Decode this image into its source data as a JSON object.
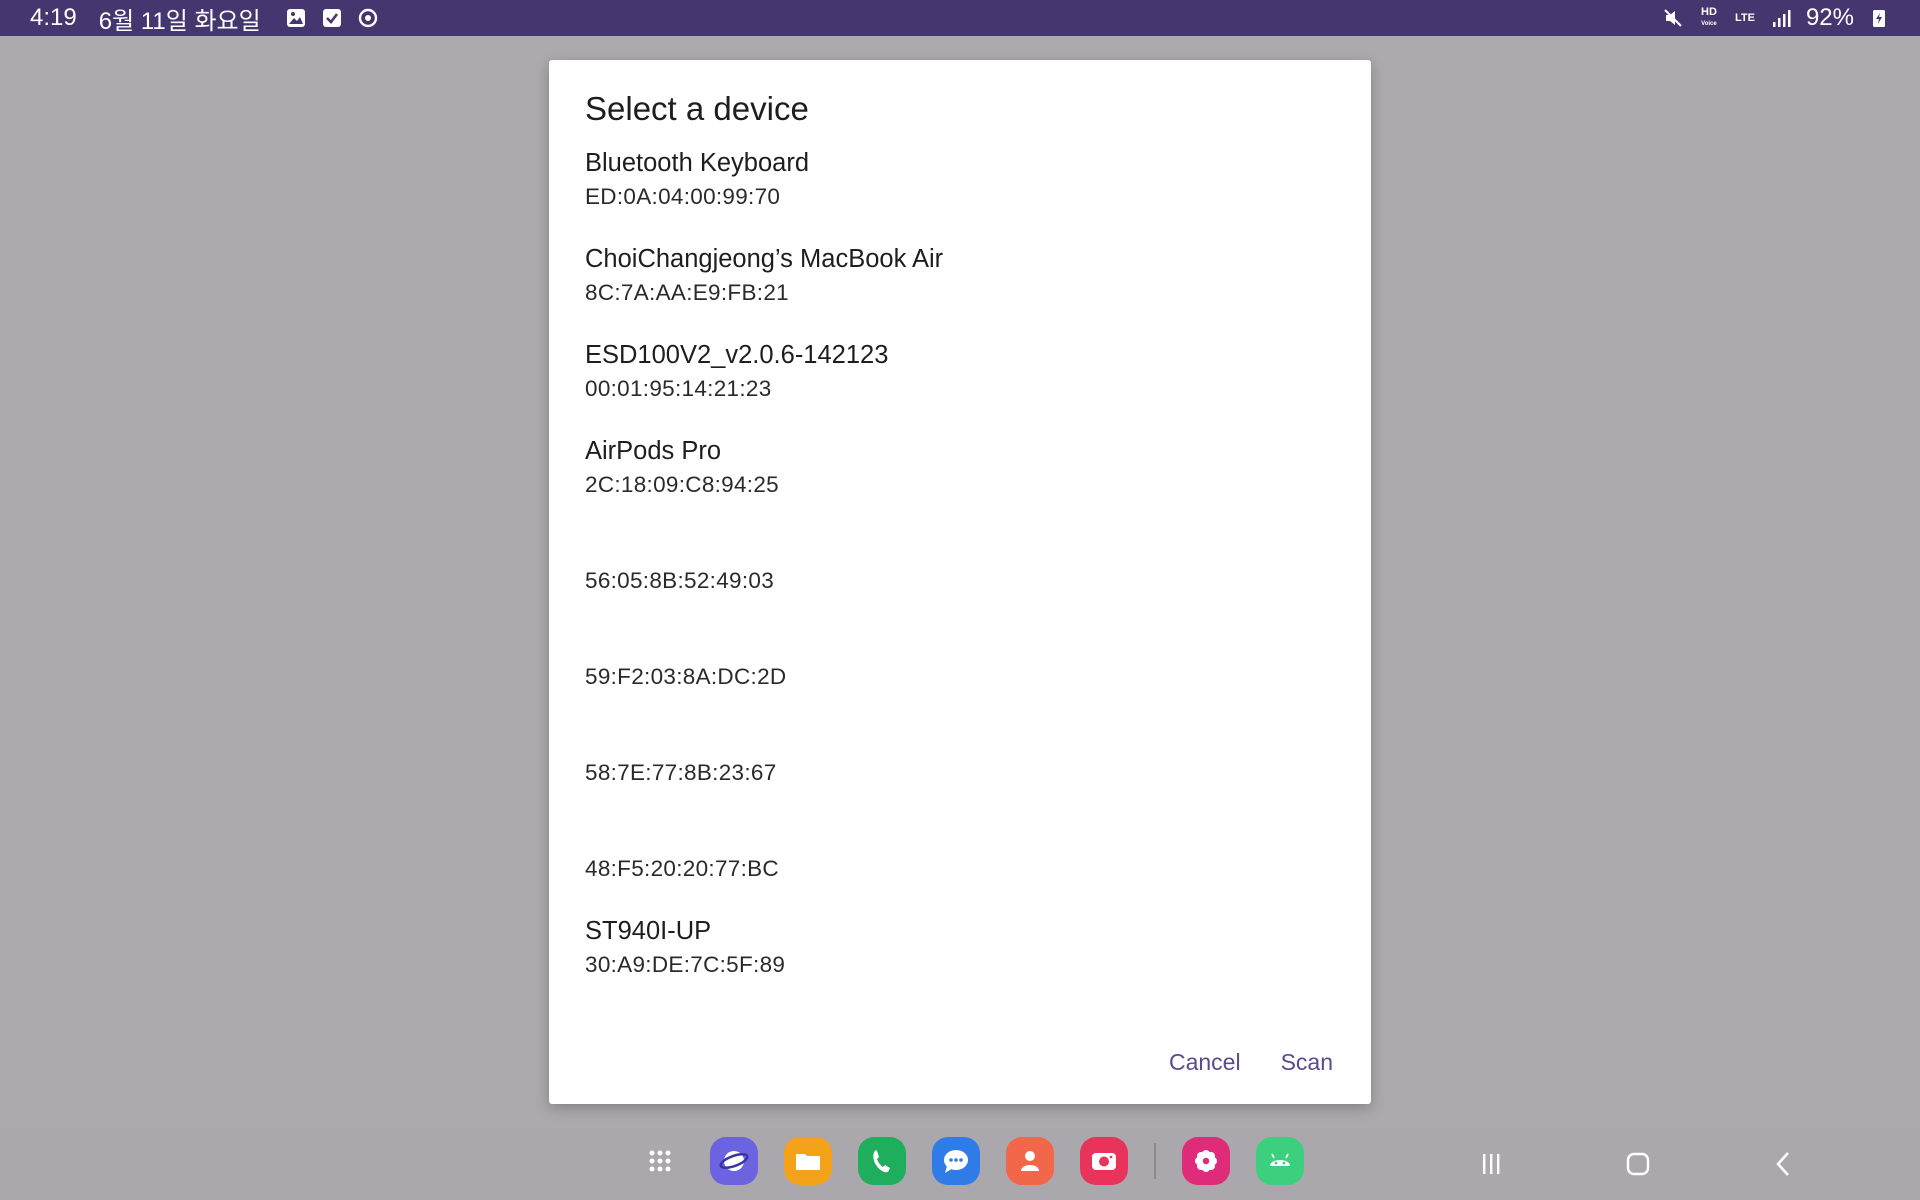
{
  "status_bar": {
    "time": "4:19",
    "date": "6월 11일 화요일",
    "battery": "92%",
    "left_icons": [
      "gallery-icon",
      "checkbox-icon",
      "sync-icon"
    ],
    "right_icons": [
      "mute-icon",
      "hd-voice-icon",
      "lte-icon",
      "signal-icon",
      "battery-charging-icon"
    ],
    "hd_label": "HD",
    "hd_sub": "Voice",
    "lte_label": "LTE"
  },
  "dialog": {
    "title": "Select a device",
    "devices": [
      {
        "name": "Bluetooth Keyboard",
        "address": "ED:0A:04:00:99:70"
      },
      {
        "name": "ChoiChangjeong’s MacBook Air",
        "address": "8C:7A:AA:E9:FB:21"
      },
      {
        "name": "ESD100V2_v2.0.6-142123",
        "address": "00:01:95:14:21:23"
      },
      {
        "name": "AirPods Pro",
        "address": "2C:18:09:C8:94:25"
      },
      {
        "name": "",
        "address": "56:05:8B:52:49:03"
      },
      {
        "name": "",
        "address": "59:F2:03:8A:DC:2D"
      },
      {
        "name": "",
        "address": "58:7E:77:8B:23:67"
      },
      {
        "name": "",
        "address": "48:F5:20:20:77:BC"
      },
      {
        "name": "ST940I-UP",
        "address": "30:A9:DE:7C:5F:89"
      }
    ],
    "cancel_label": "Cancel",
    "scan_label": "Scan"
  },
  "taskbar": {
    "apps": [
      "apps-grid-icon",
      "internet-icon",
      "files-icon",
      "phone-icon",
      "messages-icon",
      "contacts-icon",
      "camera-icon",
      "flower-app-icon",
      "android-icon"
    ],
    "colors": {
      "internet": "#6b63e0",
      "files": "#f5a21b",
      "phone": "#1fae5b",
      "messages": "#2f7be8",
      "contacts": "#f2664a",
      "camera": "#e8335a",
      "flower": "#e02a7a",
      "android": "#3ccf7e"
    }
  },
  "colors": {
    "status_bar_bg": "#463670",
    "scrim_bg": "#adaaae",
    "accent": "#5b4a8e"
  }
}
